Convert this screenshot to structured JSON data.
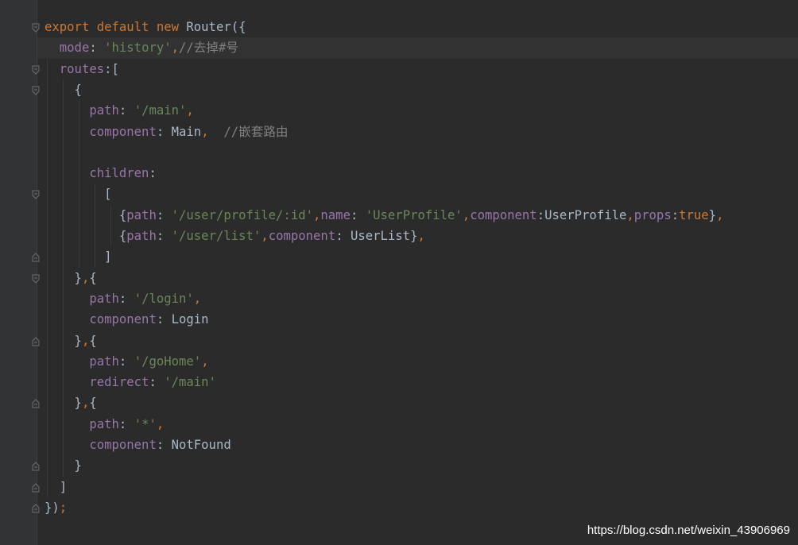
{
  "editor": {
    "lines": [
      {
        "tokens": [
          {
            "t": "k",
            "v": "export default new "
          },
          {
            "t": "i",
            "v": "Router({"
          }
        ]
      },
      {
        "tokens": [
          {
            "t": "i",
            "v": "  "
          },
          {
            "t": "p",
            "v": "mode"
          },
          {
            "t": "i",
            "v": ": "
          },
          {
            "t": "s",
            "v": "'history'"
          },
          {
            "t": "k",
            "v": ","
          },
          {
            "t": "c",
            "v": "//去掉#号"
          }
        ]
      },
      {
        "tokens": [
          {
            "t": "i",
            "v": "  "
          },
          {
            "t": "p",
            "v": "routes"
          },
          {
            "t": "i",
            "v": ":["
          }
        ]
      },
      {
        "tokens": [
          {
            "t": "i",
            "v": "    {"
          }
        ]
      },
      {
        "tokens": [
          {
            "t": "i",
            "v": "      "
          },
          {
            "t": "p",
            "v": "path"
          },
          {
            "t": "i",
            "v": ": "
          },
          {
            "t": "s",
            "v": "'/main'"
          },
          {
            "t": "k",
            "v": ","
          }
        ]
      },
      {
        "tokens": [
          {
            "t": "i",
            "v": "      "
          },
          {
            "t": "p",
            "v": "component"
          },
          {
            "t": "i",
            "v": ": Main"
          },
          {
            "t": "k",
            "v": ","
          },
          {
            "t": "i",
            "v": "  "
          },
          {
            "t": "c",
            "v": "//嵌套路由"
          }
        ]
      },
      {
        "tokens": [
          {
            "t": "i",
            "v": ""
          }
        ]
      },
      {
        "tokens": [
          {
            "t": "i",
            "v": "      "
          },
          {
            "t": "p",
            "v": "children"
          },
          {
            "t": "i",
            "v": ":"
          }
        ]
      },
      {
        "tokens": [
          {
            "t": "i",
            "v": "        ["
          }
        ]
      },
      {
        "tokens": [
          {
            "t": "i",
            "v": "          {"
          },
          {
            "t": "p",
            "v": "path"
          },
          {
            "t": "i",
            "v": ": "
          },
          {
            "t": "s",
            "v": "'/user/profile/:id'"
          },
          {
            "t": "k",
            "v": ","
          },
          {
            "t": "p",
            "v": "name"
          },
          {
            "t": "i",
            "v": ": "
          },
          {
            "t": "s",
            "v": "'UserProfile'"
          },
          {
            "t": "k",
            "v": ","
          },
          {
            "t": "p",
            "v": "component"
          },
          {
            "t": "i",
            "v": ":UserProfile"
          },
          {
            "t": "k",
            "v": ","
          },
          {
            "t": "p",
            "v": "props"
          },
          {
            "t": "i",
            "v": ":"
          },
          {
            "t": "k",
            "v": "true"
          },
          {
            "t": "i",
            "v": "}"
          },
          {
            "t": "k",
            "v": ","
          }
        ]
      },
      {
        "tokens": [
          {
            "t": "i",
            "v": "          {"
          },
          {
            "t": "p",
            "v": "path"
          },
          {
            "t": "i",
            "v": ": "
          },
          {
            "t": "s",
            "v": "'/user/list'"
          },
          {
            "t": "k",
            "v": ","
          },
          {
            "t": "p",
            "v": "component"
          },
          {
            "t": "i",
            "v": ": UserList}"
          },
          {
            "t": "k",
            "v": ","
          }
        ]
      },
      {
        "tokens": [
          {
            "t": "i",
            "v": "        ]"
          }
        ]
      },
      {
        "tokens": [
          {
            "t": "i",
            "v": "    }"
          },
          {
            "t": "k",
            "v": ","
          },
          {
            "t": "i",
            "v": "{"
          }
        ]
      },
      {
        "tokens": [
          {
            "t": "i",
            "v": "      "
          },
          {
            "t": "p",
            "v": "path"
          },
          {
            "t": "i",
            "v": ": "
          },
          {
            "t": "s",
            "v": "'/login'"
          },
          {
            "t": "k",
            "v": ","
          }
        ]
      },
      {
        "tokens": [
          {
            "t": "i",
            "v": "      "
          },
          {
            "t": "p",
            "v": "component"
          },
          {
            "t": "i",
            "v": ": Login"
          }
        ]
      },
      {
        "tokens": [
          {
            "t": "i",
            "v": "    }"
          },
          {
            "t": "k",
            "v": ","
          },
          {
            "t": "i",
            "v": "{"
          }
        ]
      },
      {
        "tokens": [
          {
            "t": "i",
            "v": "      "
          },
          {
            "t": "p",
            "v": "path"
          },
          {
            "t": "i",
            "v": ": "
          },
          {
            "t": "s",
            "v": "'/goHome'"
          },
          {
            "t": "k",
            "v": ","
          }
        ]
      },
      {
        "tokens": [
          {
            "t": "i",
            "v": "      "
          },
          {
            "t": "p",
            "v": "redirect"
          },
          {
            "t": "i",
            "v": ": "
          },
          {
            "t": "s",
            "v": "'/main'"
          }
        ]
      },
      {
        "tokens": [
          {
            "t": "i",
            "v": "    }"
          },
          {
            "t": "k",
            "v": ","
          },
          {
            "t": "i",
            "v": "{"
          }
        ]
      },
      {
        "tokens": [
          {
            "t": "i",
            "v": "      "
          },
          {
            "t": "p",
            "v": "path"
          },
          {
            "t": "i",
            "v": ": "
          },
          {
            "t": "s",
            "v": "'*'"
          },
          {
            "t": "k",
            "v": ","
          }
        ]
      },
      {
        "tokens": [
          {
            "t": "i",
            "v": "      "
          },
          {
            "t": "p",
            "v": "component"
          },
          {
            "t": "i",
            "v": ": NotFound"
          }
        ]
      },
      {
        "tokens": [
          {
            "t": "i",
            "v": "    }"
          }
        ]
      },
      {
        "tokens": [
          {
            "t": "i",
            "v": "  ]"
          }
        ]
      },
      {
        "tokens": [
          {
            "t": "i",
            "v": "})"
          },
          {
            "t": "k",
            "v": ";"
          }
        ]
      }
    ],
    "caret_line_index": 1
  },
  "colors": {
    "background": "#2b2b2b",
    "gutter": "#313335",
    "keyword": "#cc7832",
    "property": "#9876aa",
    "string": "#6a8759",
    "comment": "#808080",
    "identifier": "#a9b7c6"
  },
  "watermark": "https://blog.csdn.net/weixin_43906969"
}
